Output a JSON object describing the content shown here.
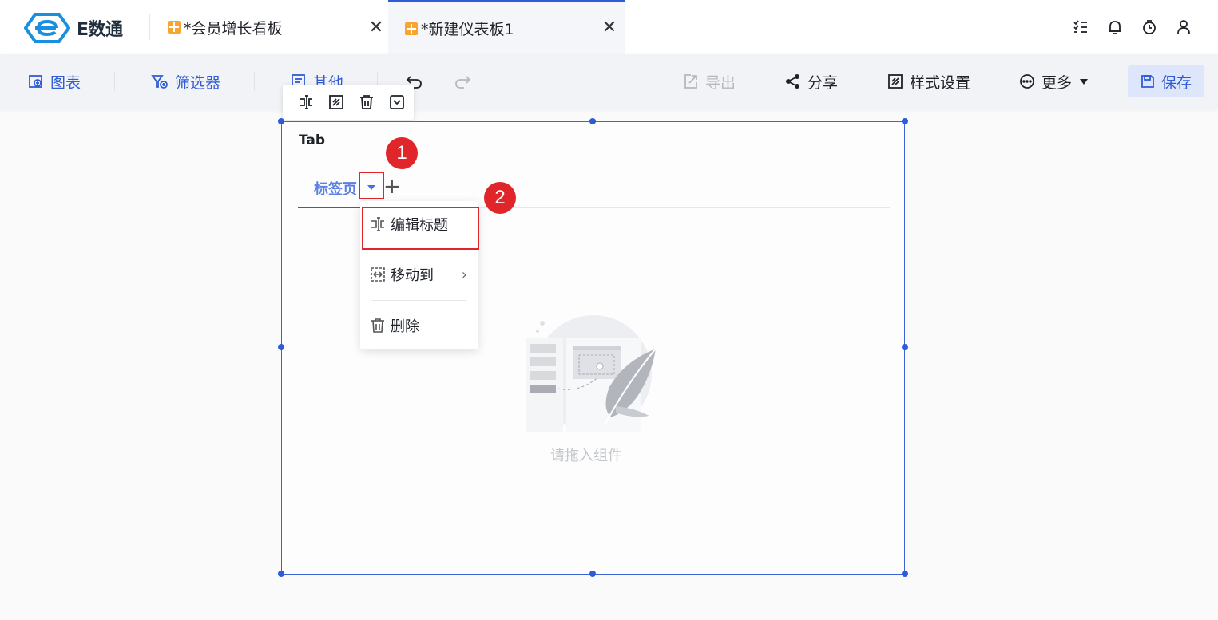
{
  "app": {
    "logo_text": "E数通"
  },
  "doc_tabs": [
    {
      "label": "*会员增长看板",
      "close": "✕",
      "active": false
    },
    {
      "label": "*新建仪表板1",
      "close": "✕",
      "active": true
    }
  ],
  "top_icons": [
    "task-list-icon",
    "bell-icon",
    "timer-icon",
    "user-icon"
  ],
  "toolbar": {
    "chart": "图表",
    "filter": "筛选器",
    "other": "其他",
    "export": "导出",
    "share": "分享",
    "style": "样式设置",
    "more": "更多",
    "save": "保存"
  },
  "component": {
    "title": "Tab",
    "tab_label": "标签页",
    "add": "+",
    "empty_hint": "请拖入组件"
  },
  "menu": {
    "edit_title": "编辑标题",
    "move_to": "移动到",
    "delete": "删除",
    "chevron": "›"
  },
  "callouts": [
    "1",
    "2"
  ],
  "colors": {
    "accent": "#2f5bd6",
    "highlight": "#e0262a",
    "tab_icon": "#f7a531"
  }
}
